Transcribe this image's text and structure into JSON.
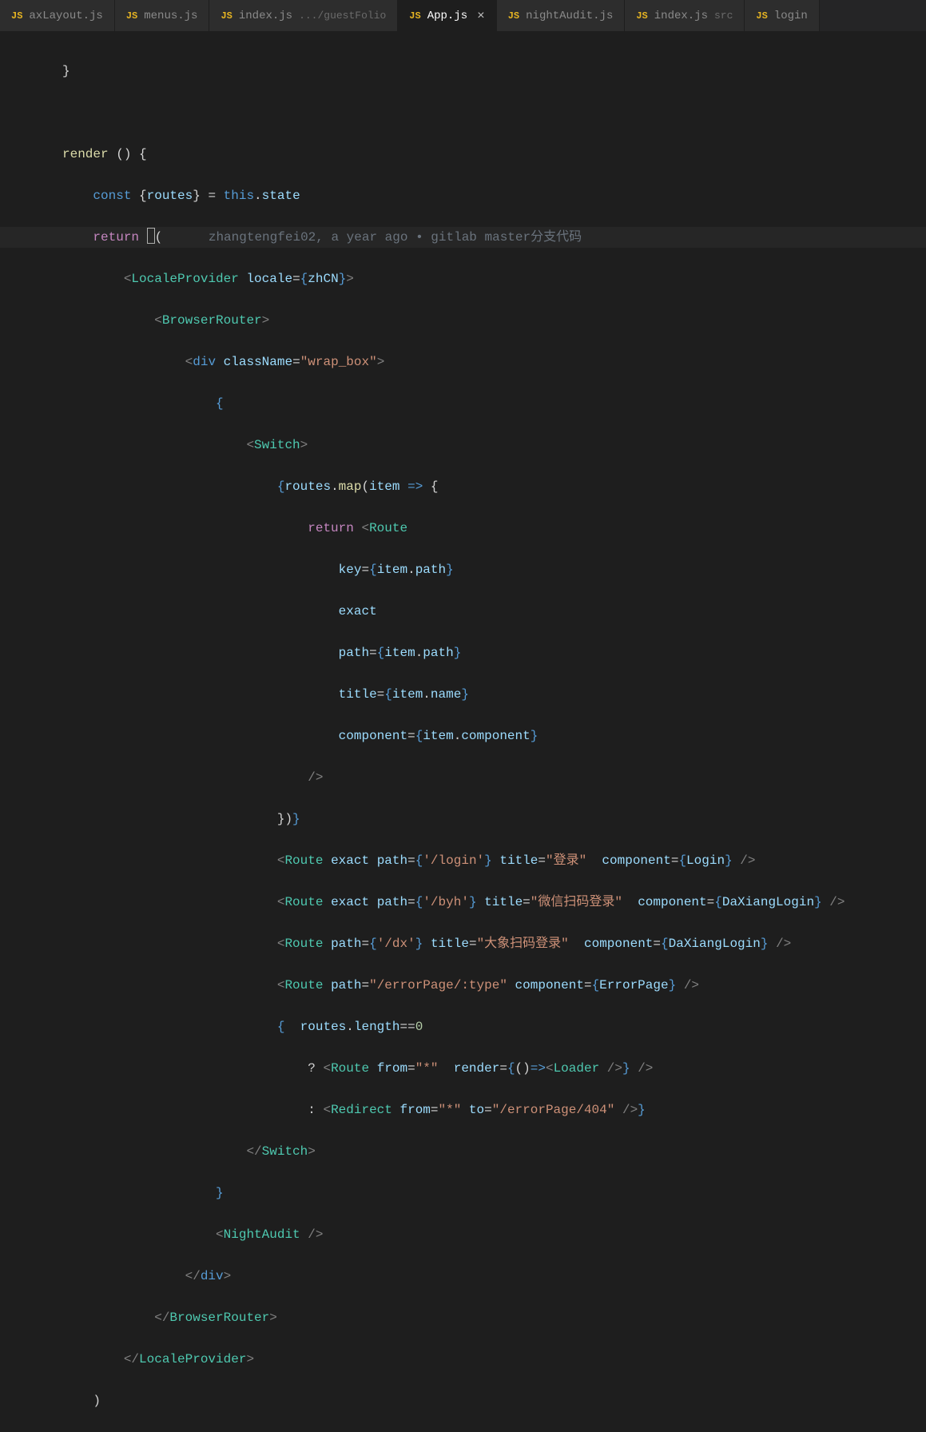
{
  "tabs": [
    {
      "icon": "JS",
      "name": "axLayout.js",
      "dir": "",
      "active": false,
      "close": false
    },
    {
      "icon": "JS",
      "name": "menus.js",
      "dir": "",
      "active": false,
      "close": false
    },
    {
      "icon": "JS",
      "name": "index.js",
      "dir": ".../guestFolio",
      "active": false,
      "close": false
    },
    {
      "icon": "JS",
      "name": "App.js",
      "dir": "",
      "active": true,
      "close": true
    },
    {
      "icon": "JS",
      "name": "nightAudit.js",
      "dir": "",
      "active": false,
      "close": false
    },
    {
      "icon": "JS",
      "name": "index.js",
      "dir": "src",
      "active": false,
      "close": false
    },
    {
      "icon": "JS",
      "name": "login",
      "dir": "",
      "active": false,
      "close": false
    }
  ],
  "blame": "zhangtengfei02, a year ago • gitlab master分支代码",
  "code": {
    "render": "render",
    "const": "const",
    "return": "return",
    "this": "this",
    "routesVar": "routes",
    "state": "state",
    "LocaleProvider": "LocaleProvider",
    "locale": "locale",
    "zhCN": "zhCN",
    "BrowserRouter": "BrowserRouter",
    "div": "div",
    "className": "className",
    "wrap_box": "\"wrap_box\"",
    "Switch": "Switch",
    "map": "map",
    "item": "item",
    "Route": "Route",
    "key": "key",
    "path": "path",
    "exact": "exact",
    "title": "title",
    "name": "name",
    "component": "component",
    "loginPath": "'/login'",
    "loginTitle": "\"登录\"",
    "Login": "Login",
    "byhPath": "'/byh'",
    "byhTitle": "\"微信扫码登录\"",
    "DaXiangLogin": "DaXiangLogin",
    "dxPath": "'/dx'",
    "dxTitle": "\"大象扫码登录\"",
    "errorPath": "\"/errorPage/:type\"",
    "ErrorPage": "ErrorPage",
    "length": "length",
    "zero": "0",
    "from": "from",
    "star": "\"*\"",
    "renderProp": "render",
    "Loader": "Loader",
    "Redirect": "Redirect",
    "to": "to",
    "errorTo": "\"/errorPage/404\"",
    "NightAudit": "NightAudit"
  }
}
